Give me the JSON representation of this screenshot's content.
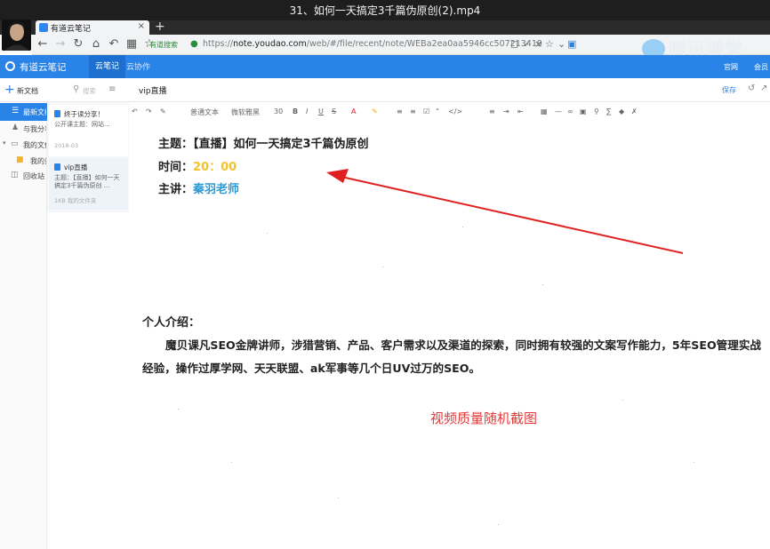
{
  "video": {
    "title": "31、如何一天搞定3千篇伪原创(2).mp4"
  },
  "browser": {
    "tab_title": "有道云笔记",
    "tab_close": "×",
    "new_tab": "+",
    "secure_label": "有道搜索",
    "url_prefix": "https://",
    "url_host": "note.youdao.com",
    "url_path": "/web/#/file/recent/note/WEBa2ea0aa5946cc507213419",
    "nav_icons": [
      "arrow-left-icon",
      "arrow-right-icon",
      "reload-icon",
      "home-icon",
      "undo-icon",
      "grid-icon",
      "star-icon"
    ],
    "toolbar_icons": [
      "translate-icon",
      "lightning-icon",
      "close-icon",
      "star-icon",
      "chevron-down-icon",
      "screenshot-icon"
    ]
  },
  "watermark": {
    "text": "腾讯课堂"
  },
  "app": {
    "brand": "有道云笔记",
    "tabs": [
      {
        "label": "云笔记"
      },
      {
        "label": "云协作"
      }
    ],
    "header_right": [
      "官网",
      "会员"
    ]
  },
  "toolbar": {
    "new_doc": "新文档",
    "search_placeholder": "搜索",
    "note_title": "vip直播",
    "save": "保存"
  },
  "sidebar": {
    "items": [
      {
        "label": "最新文档",
        "icon": "layers-icon"
      },
      {
        "label": "与我分享",
        "icon": "share-icon"
      },
      {
        "label": "我的文件夹",
        "icon": "folder-icon"
      },
      {
        "label": "我的资源",
        "icon": "folder-yellow-icon"
      },
      {
        "label": "回收站",
        "icon": "trash-icon"
      }
    ]
  },
  "notes": [
    {
      "title": "终于读分享！",
      "body": "公开课主题：网站...",
      "date": "2018-03"
    },
    {
      "title": "vip直播",
      "body": "主题：【直播】如何一天搞定3千篇伪原创 ...",
      "date": "1KB 我的文件夹"
    }
  ],
  "editor_toolbar": [
    "普通文本",
    "微软雅黑",
    "30",
    "B",
    "I",
    "U",
    "S",
    "A"
  ],
  "content": {
    "topic_label": "主题：",
    "topic_value": "【直播】如何一天搞定3千篇伪原创",
    "time_label": "时间：",
    "time_value": "20：00",
    "speaker_label": "主讲：",
    "speaker_value": "秦羽老师",
    "intro_heading": "个人介绍：",
    "intro_body": "魔贝课凡SEO金牌讲师，涉猎营销、产品、客户需求以及渠道的探索，同时拥有较强的文案写作能力，5年SEO管理实战经验，操作过厚学网、天天联盟、ak军事等几个日UV过万的SEO。",
    "caption": "视频质量随机截图"
  },
  "colors": {
    "app_blue": "#2a84e8",
    "time_yellow": "#f3c230",
    "teacher_blue": "#2a9bd6",
    "arrow_red": "#e0201e",
    "caption_red": "#e03a3a"
  }
}
